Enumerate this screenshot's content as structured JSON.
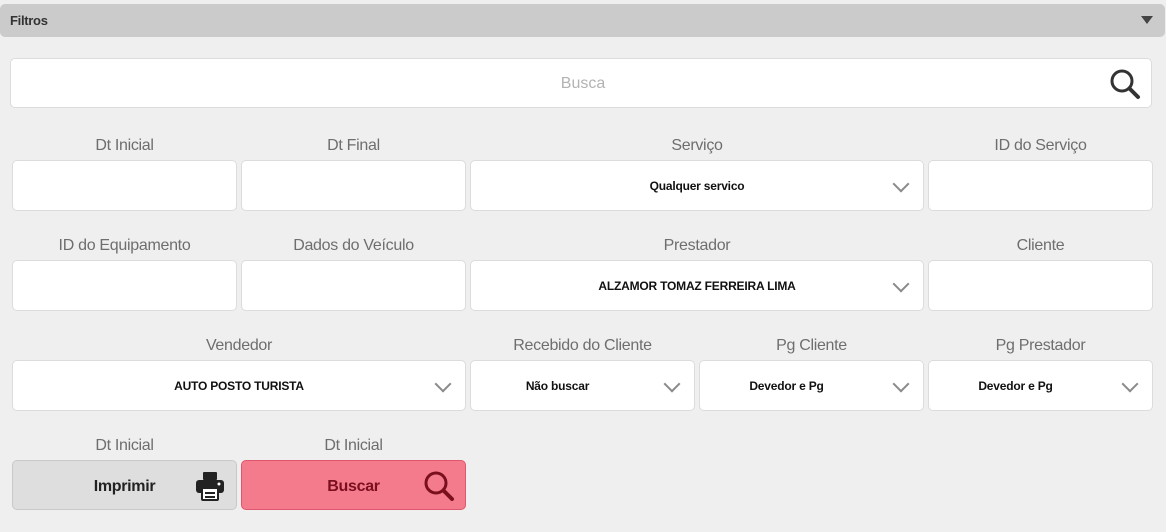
{
  "header": {
    "title": "Filtros",
    "toggle_icon": "caret-down-icon"
  },
  "search": {
    "placeholder": "Busca",
    "value": "",
    "icon": "search-icon"
  },
  "filters": {
    "dt_inicial": {
      "label": "Dt Inicial",
      "value": ""
    },
    "dt_final": {
      "label": "Dt Final",
      "value": ""
    },
    "servico": {
      "label": "Serviço",
      "value": "Qualquer servico"
    },
    "id_servico": {
      "label": "ID do Serviço",
      "value": ""
    },
    "id_equipamento": {
      "label": "ID do Equipamento",
      "value": ""
    },
    "dados_veiculo": {
      "label": "Dados do Veículo",
      "value": ""
    },
    "prestador": {
      "label": "Prestador",
      "value": "ALZAMOR TOMAZ FERREIRA LIMA"
    },
    "cliente": {
      "label": "Cliente",
      "value": ""
    },
    "vendedor": {
      "label": "Vendedor",
      "value": "AUTO POSTO TURISTA"
    },
    "recebido_cliente": {
      "label": "Recebido do Cliente",
      "value": "Não buscar"
    },
    "pg_cliente": {
      "label": "Pg Cliente",
      "value": "Devedor e Pg"
    },
    "pg_prestador": {
      "label": "Pg Prestador",
      "value": "Devedor e Pg"
    }
  },
  "actions": {
    "print": {
      "label_above": "Dt Inicial",
      "label": "Imprimir",
      "icon": "printer-icon"
    },
    "search": {
      "label_above": "Dt Inicial",
      "label": "Buscar",
      "icon": "search-icon"
    }
  },
  "colors": {
    "accent": "#f47b8c",
    "accent_dark": "#7a0f1e",
    "header_bg": "#cbcbcb"
  }
}
